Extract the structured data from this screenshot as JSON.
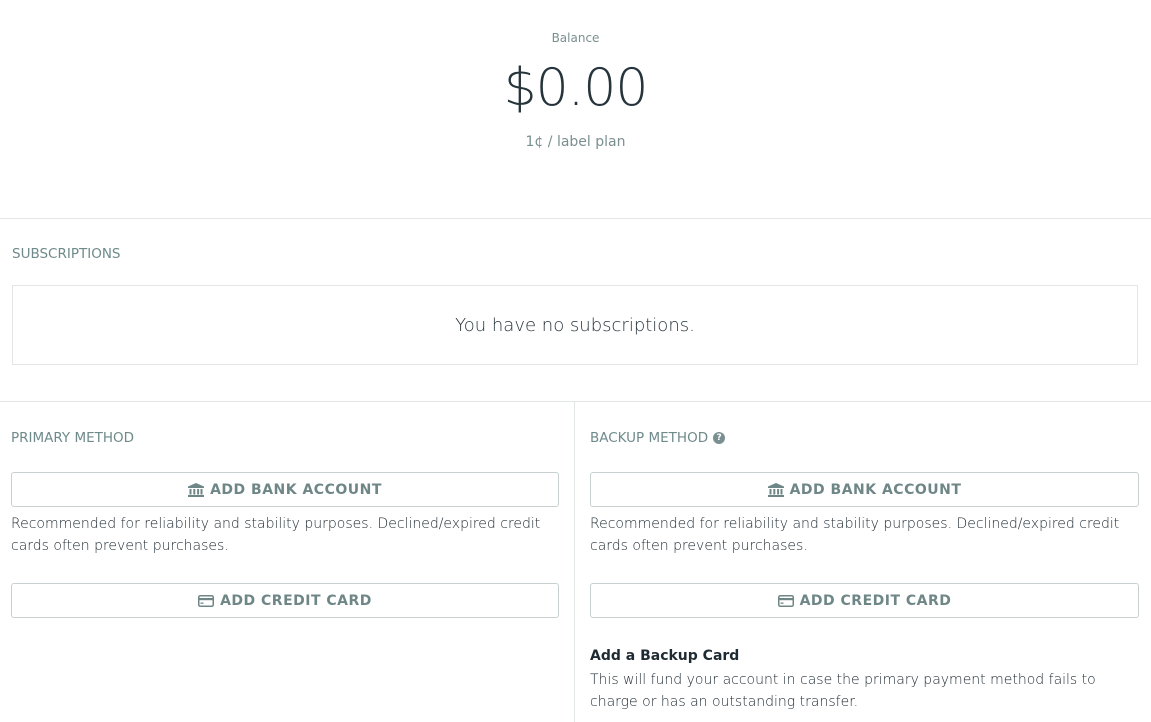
{
  "balance": {
    "label": "Balance",
    "amount": "$0.00",
    "plan": "1¢ / label plan"
  },
  "subscriptions": {
    "title": "SUBSCRIPTIONS",
    "empty_text": "You have no subscriptions."
  },
  "primary_method": {
    "title": "PRIMARY METHOD",
    "add_bank_label": "ADD BANK ACCOUNT",
    "note": "Recommended for reliability and stability purposes. Declined/expired credit cards often prevent purchases.",
    "add_card_label": "ADD CREDIT CARD"
  },
  "backup_method": {
    "title": "BACKUP METHOD",
    "help_icon": "question-circle-icon",
    "add_bank_label": "ADD BANK ACCOUNT",
    "note": "Recommended for reliability and stability purposes. Declined/expired credit cards often prevent purchases.",
    "add_card_label": "ADD CREDIT CARD",
    "backup_card_heading": "Add a Backup Card",
    "backup_card_text": "This will fund your account in case the primary payment method fails to charge or has an outstanding transfer."
  },
  "colors": {
    "accent_text": "#6f8a8b",
    "border": "#e3e6e6",
    "button_border": "#c9d0d1"
  }
}
